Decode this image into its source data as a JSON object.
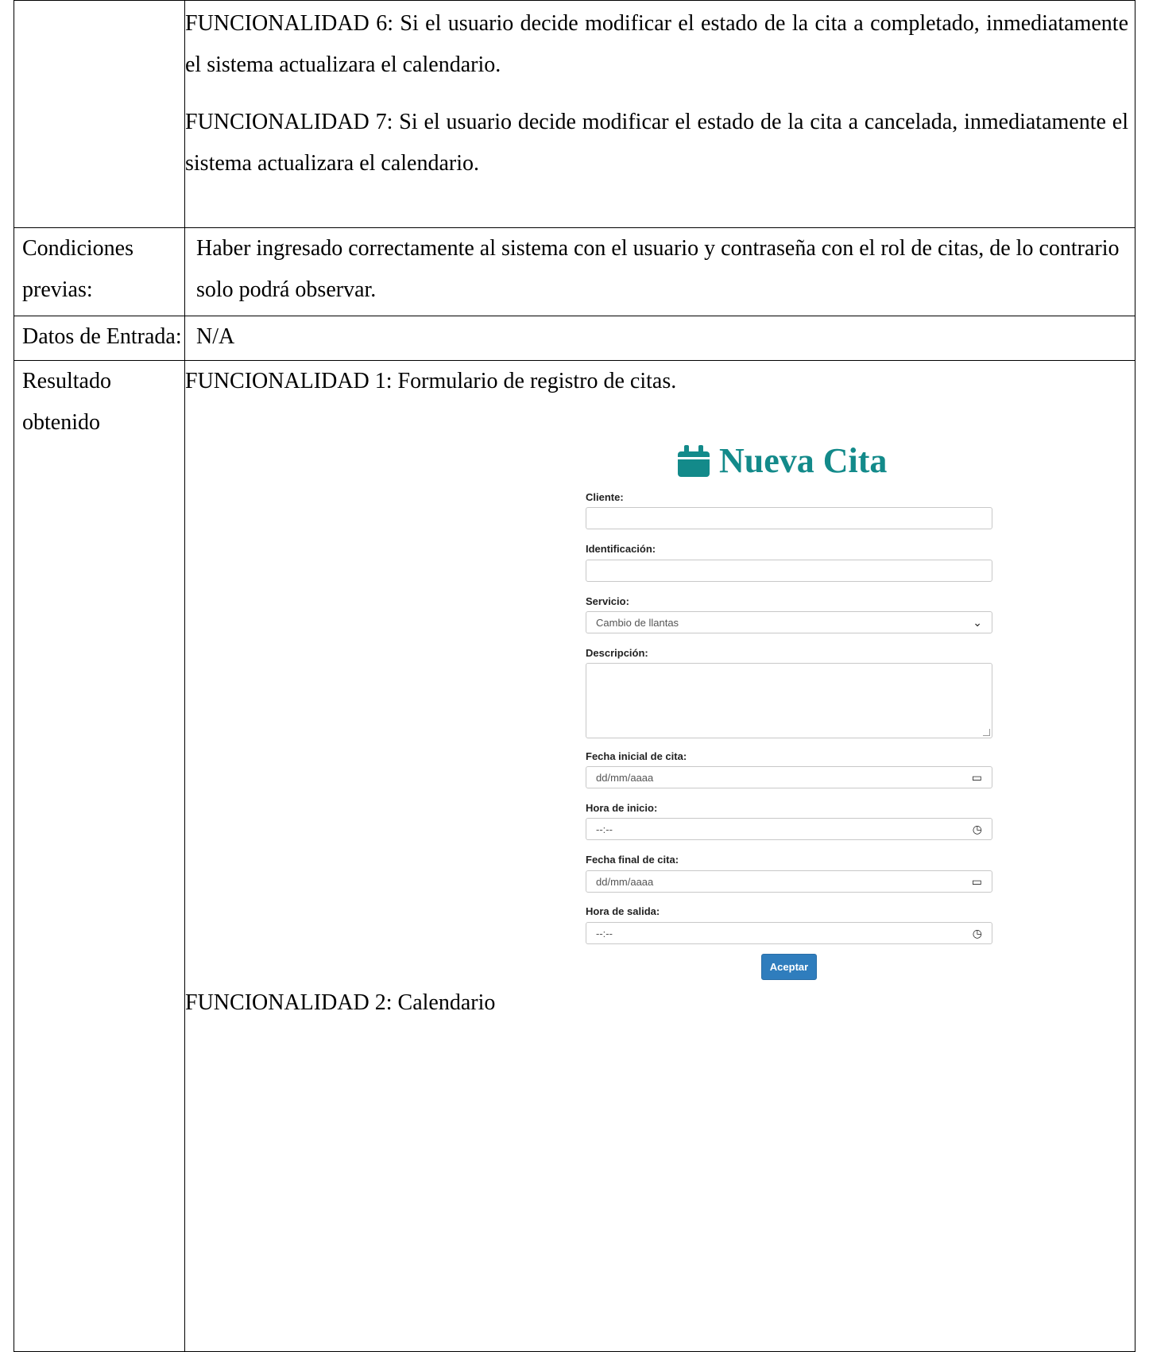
{
  "rows": {
    "funcionalidades": {
      "f6": "FUNCIONALIDAD 6: Si el usuario decide modificar el estado de la cita a completado, inmediatamente el sistema actualizara el calendario.",
      "f7": "FUNCIONALIDAD 7: Si el usuario decide modificar el estado de la cita a cancelada, inmediatamente el sistema actualizara el calendario."
    },
    "condiciones": {
      "label_line1": "Condiciones",
      "label_line2": "previas:",
      "value": "Haber ingresado correctamente al sistema con el usuario y contraseña con el rol de citas, de lo contrario solo podrá observar."
    },
    "datos": {
      "label": "Datos de Entrada:",
      "value": "N/A"
    },
    "resultado": {
      "label_line1": "Resultado",
      "label_line2": "obtenido",
      "f1": "FUNCIONALIDAD 1: Formulario de registro de citas.",
      "f2": "FUNCIONALIDAD 2: Calendario"
    }
  },
  "form": {
    "title": "Nueva Cita",
    "icon": "calendar-icon",
    "accent_color": "#138a8a",
    "fields": {
      "cliente": {
        "label": "Cliente:",
        "value": ""
      },
      "identificacion": {
        "label": "Identificación:",
        "value": ""
      },
      "servicio": {
        "label": "Servicio:",
        "value": "Cambio de llantas"
      },
      "descripcion": {
        "label": "Descripción:",
        "value": ""
      },
      "fecha_inicial": {
        "label": "Fecha inicial de cita:",
        "placeholder": "dd/mm/aaaa"
      },
      "hora_inicio": {
        "label": "Hora de inicio:",
        "placeholder": "--:--"
      },
      "fecha_final": {
        "label": "Fecha final de cita:",
        "placeholder": "dd/mm/aaaa"
      },
      "hora_salida": {
        "label": "Hora de salida:",
        "placeholder": "--:--"
      }
    },
    "submit_label": "Aceptar",
    "button_color": "#2f7dbd"
  }
}
